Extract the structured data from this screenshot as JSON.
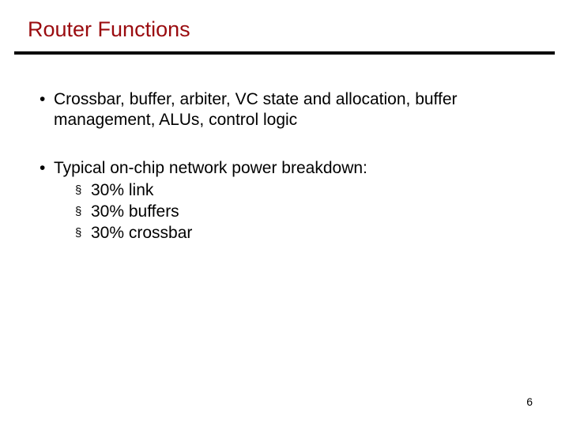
{
  "slide": {
    "title": "Router Functions",
    "bullets": [
      {
        "text": "Crossbar, buffer, arbiter, VC state and allocation, buffer management, ALUs, control logic",
        "sub": []
      },
      {
        "text": "Typical on-chip network power breakdown:",
        "sub": [
          "30% link",
          "30% buffers",
          "30% crossbar"
        ]
      }
    ],
    "page_number": "6"
  },
  "glyphs": {
    "bullet": "•",
    "square": "§"
  }
}
